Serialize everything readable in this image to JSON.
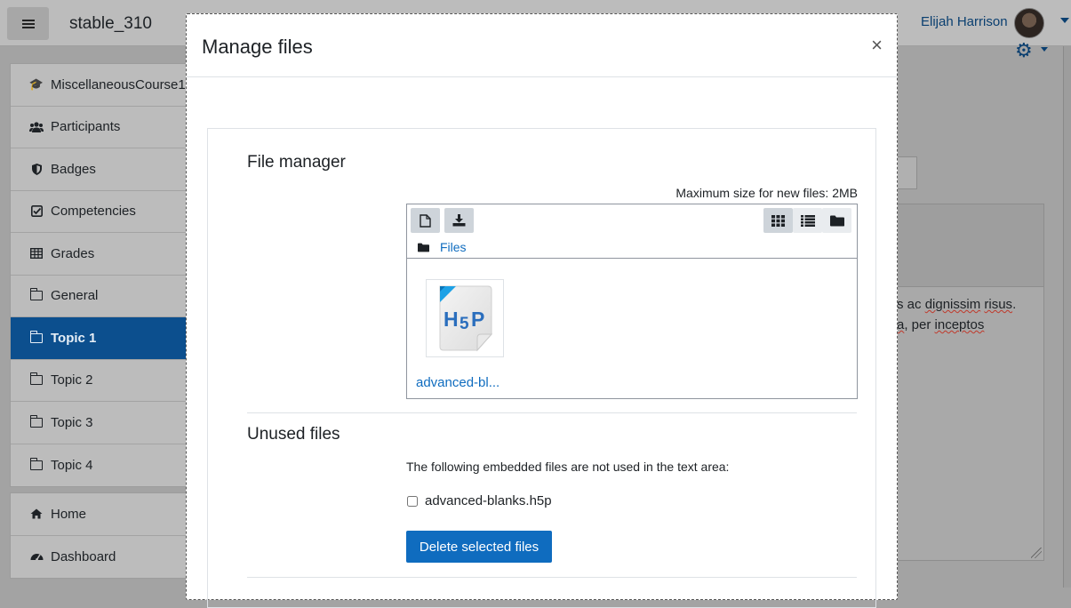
{
  "navbar": {
    "site_name": "stable_310",
    "user_name": "Elijah Harrison"
  },
  "drawer": {
    "course_items": [
      {
        "label": "MiscellaneousCourse1",
        "icon": "graduation-cap-icon"
      },
      {
        "label": "Participants",
        "icon": "users-icon"
      },
      {
        "label": "Badges",
        "icon": "shield-icon"
      },
      {
        "label": "Competencies",
        "icon": "checkbox-icon"
      },
      {
        "label": "Grades",
        "icon": "table-icon"
      },
      {
        "label": "General",
        "icon": "folder-icon"
      },
      {
        "label": "Topic 1",
        "icon": "folder-icon",
        "active": true
      },
      {
        "label": "Topic 2",
        "icon": "folder-icon"
      },
      {
        "label": "Topic 3",
        "icon": "folder-icon"
      },
      {
        "label": "Topic 4",
        "icon": "folder-icon"
      }
    ],
    "site_items": [
      {
        "label": "Home",
        "icon": "home-icon"
      },
      {
        "label": "Dashboard",
        "icon": "dashboard-icon"
      }
    ]
  },
  "background_editor": {
    "line1_prefix": "s ac ",
    "line1_w1": "dignissim",
    "line1_sep": " ",
    "line1_w2": "risus",
    "line1_end": ".",
    "line2_w1": "a",
    "line2_mid": ", per ",
    "line2_w2": "inceptos"
  },
  "modal": {
    "title": "Manage files",
    "close_symbol": "×",
    "file_manager": {
      "title": "File manager",
      "max_size": "Maximum size for new files: 2MB",
      "path_label": "Files",
      "files": [
        {
          "name": "advanced-bl...",
          "icon": "h5p-file-icon"
        }
      ]
    },
    "unused": {
      "title": "Unused files",
      "note": "The following embedded files are not used in the text area:",
      "items": [
        {
          "name": "advanced-blanks.h5p",
          "checked": false
        }
      ],
      "delete_label": "Delete selected files"
    }
  },
  "colors": {
    "primary": "#0f6cbf",
    "active_nav": "#0c4f8e"
  }
}
